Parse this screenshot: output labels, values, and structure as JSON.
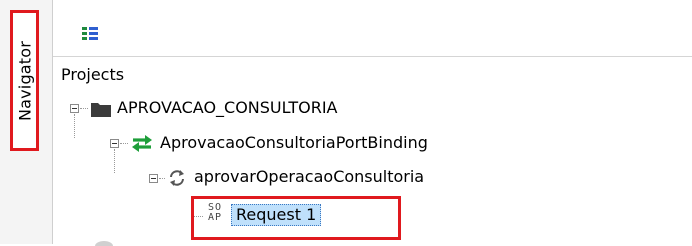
{
  "navigator": {
    "tab_label": "Navigator"
  },
  "toolbar": {
    "tree_icon": "list-tree-icon"
  },
  "tree": {
    "root_label": "Projects",
    "project": {
      "label": "APROVACAO_CONSULTORIA",
      "icon": "folder-icon"
    },
    "binding": {
      "label": "AprovacaoConsultoriaPortBinding",
      "icon": "exchange-arrows-icon"
    },
    "operation": {
      "label": "aprovarOperacaoConsultoria",
      "icon": "cycle-arrows-icon"
    },
    "request": {
      "label": "Request 1",
      "icon_text_top": "SO",
      "icon_text_bottom": "AP"
    }
  },
  "colors": {
    "highlight_border": "#e0191e",
    "binding_icon": "#1e9e3a",
    "selection": "#bfe0fb"
  }
}
